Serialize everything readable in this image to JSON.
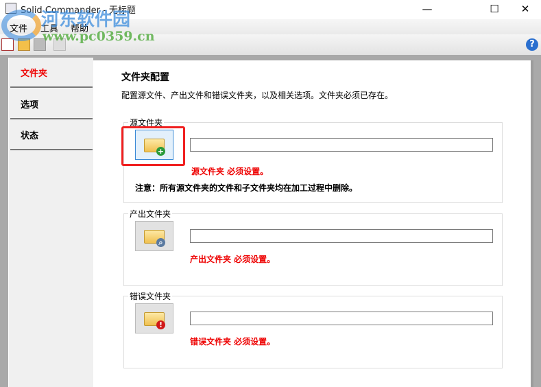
{
  "window": {
    "title": "Solid Commander - 无标题",
    "minimize": "—",
    "maximize": "☐",
    "close": "✕"
  },
  "watermark": {
    "cn": "河东软件园",
    "url": "www.pc0359.cn"
  },
  "menu": [
    "文件",
    "工具",
    "帮助"
  ],
  "toolbar": {
    "icons": [
      "new-icon",
      "open-icon",
      "save-icon",
      "run-icon"
    ],
    "help": "?"
  },
  "tabs": [
    {
      "label": "文件夹",
      "active": true
    },
    {
      "label": "选项"
    },
    {
      "label": "状态"
    }
  ],
  "main": {
    "title": "文件夹配置",
    "description": "配置源文件、产出文件和错误文件夹，以及相关选项。文件夹必须已存在。",
    "groups": [
      {
        "label": "源文件夹",
        "value": "",
        "error": "源文件夹 必须设置。",
        "note": "注意：所有源文件夹的文件和子文件夹均在加工过程中删除。",
        "badge": "+",
        "badge_color": "#2a9a3a"
      },
      {
        "label": "产出文件夹",
        "value": "",
        "error": "产出文件夹 必须设置。",
        "badge": "⌕",
        "badge_color": "#5a7aa0"
      },
      {
        "label": "错误文件夹",
        "value": "",
        "error": "错误文件夹 必须设置。",
        "badge": "!",
        "badge_color": "#d01818"
      }
    ]
  }
}
